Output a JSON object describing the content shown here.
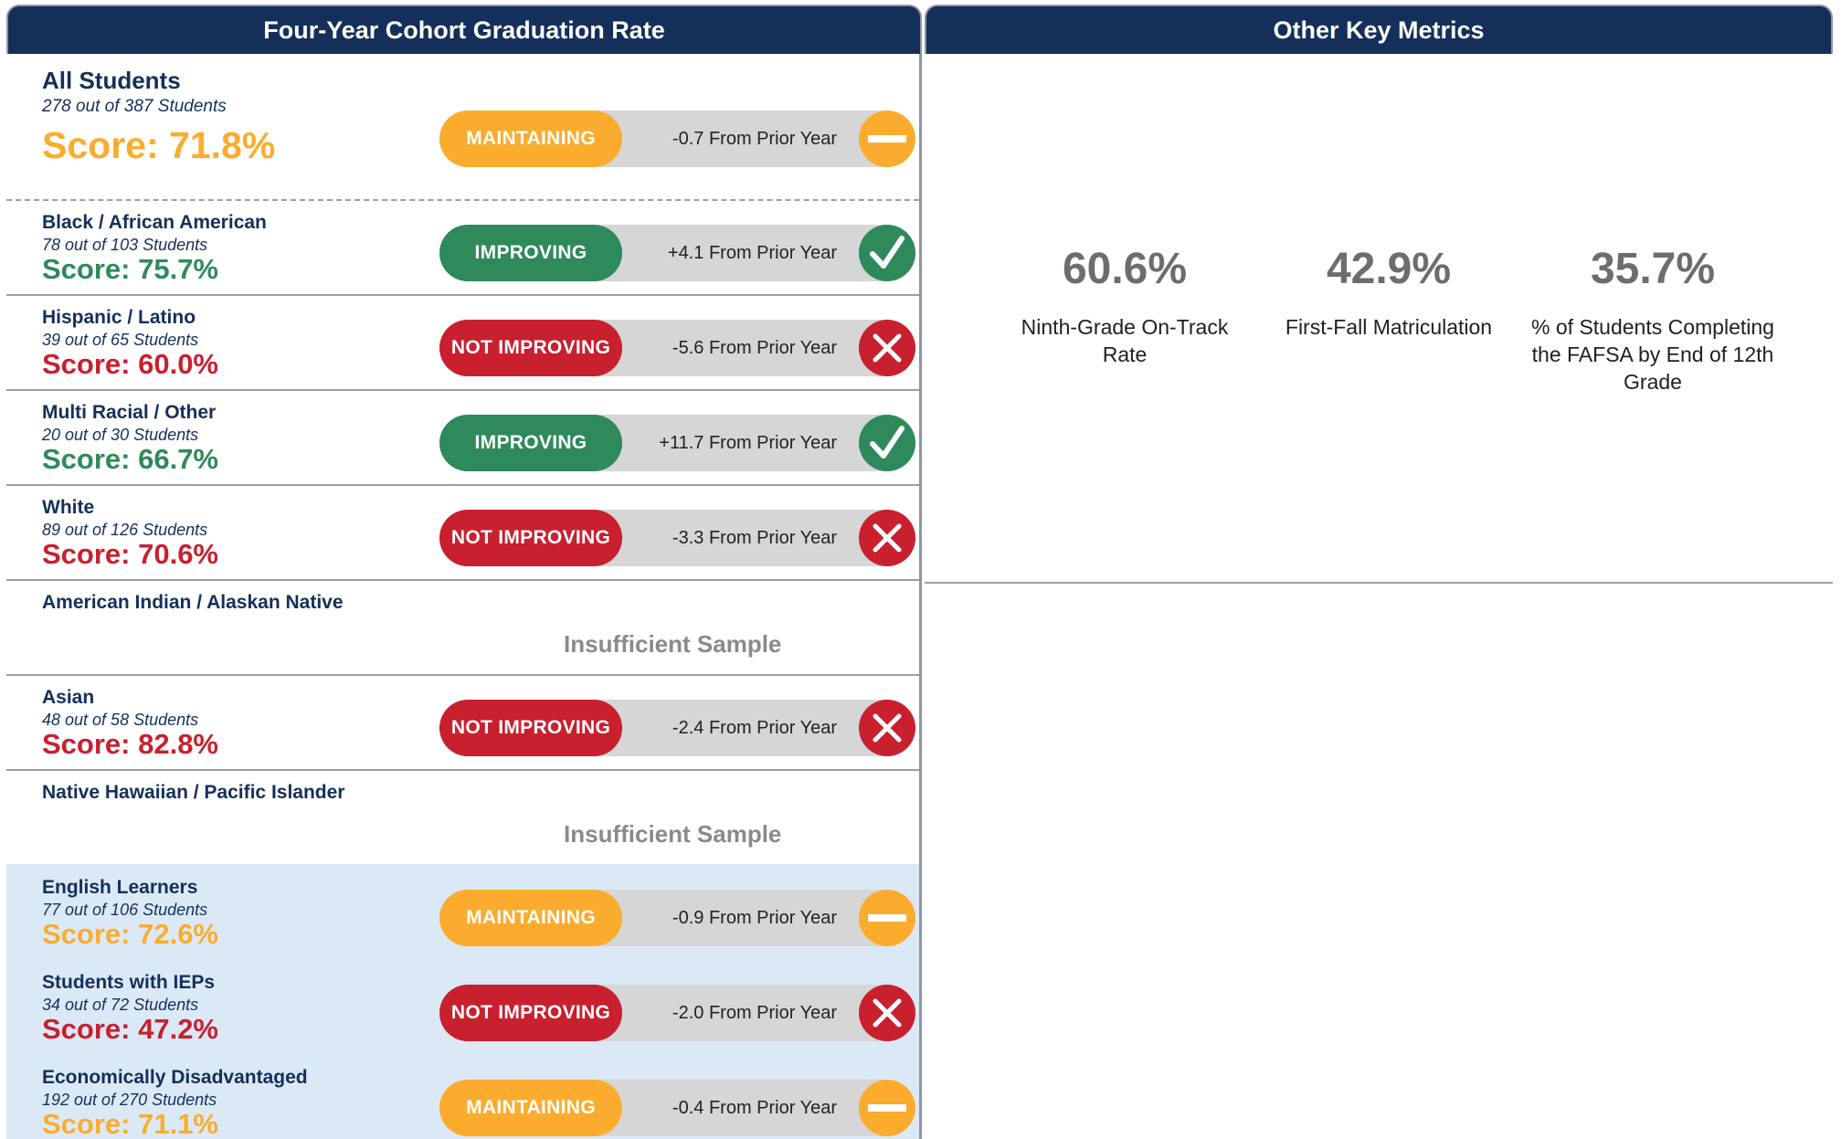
{
  "headers": {
    "left": "Four-Year Cohort Graduation Rate",
    "right": "Other Key Metrics"
  },
  "colors": {
    "header_bg": "#14305a",
    "maintaining": "#fbac2e",
    "improving": "#2f8a5b",
    "not_improving": "#c8202f",
    "highlight_bg": "#dbe9f6",
    "insufficient_text": "#8a8a8a"
  },
  "groups": [
    {
      "name": "All Students",
      "count": "278 out of 387 Students",
      "score": "Score: 71.8%",
      "status": "MAINTAINING",
      "change": "-0.7 From Prior Year",
      "icon": "minus-icon"
    },
    {
      "name": "Black / African American",
      "count": "78 out of 103 Students",
      "score": "Score: 75.7%",
      "status": "IMPROVING",
      "change": "+4.1 From Prior Year",
      "icon": "check-icon"
    },
    {
      "name": "Hispanic / Latino",
      "count": "39 out of 65 Students",
      "score": "Score: 60.0%",
      "status": "NOT IMPROVING",
      "change": "-5.6 From Prior Year",
      "icon": "x-icon"
    },
    {
      "name": "Multi Racial / Other",
      "count": "20 out of 30 Students",
      "score": "Score: 66.7%",
      "status": "IMPROVING",
      "change": "+11.7 From Prior Year",
      "icon": "check-icon"
    },
    {
      "name": "White",
      "count": "89 out of 126 Students",
      "score": "Score: 70.6%",
      "status": "NOT IMPROVING",
      "change": "-3.3 From Prior Year",
      "icon": "x-icon"
    },
    {
      "name": "American Indian / Alaskan Native",
      "insufficient": "Insufficient Sample"
    },
    {
      "name": "Asian",
      "count": "48 out of 58 Students",
      "score": "Score: 82.8%",
      "status": "NOT IMPROVING",
      "change": "-2.4 From Prior Year",
      "icon": "x-icon"
    },
    {
      "name": "Native Hawaiian / Pacific Islander",
      "insufficient": "Insufficient Sample"
    },
    {
      "name": "English Learners",
      "count": "77 out of 106 Students",
      "score": "Score: 72.6%",
      "status": "MAINTAINING",
      "change": "-0.9 From Prior Year",
      "icon": "minus-icon"
    },
    {
      "name": "Students with IEPs",
      "count": "34 out of 72 Students",
      "score": "Score: 47.2%",
      "status": "NOT IMPROVING",
      "change": "-2.0 From Prior Year",
      "icon": "x-icon"
    },
    {
      "name": "Economically Disadvantaged",
      "count": "192 out of 270 Students",
      "score": "Score: 71.1%",
      "status": "MAINTAINING",
      "change": "-0.4 From Prior Year",
      "icon": "minus-icon"
    }
  ],
  "metrics": [
    {
      "value": "60.6%",
      "label": "Ninth-Grade On-Track Rate"
    },
    {
      "value": "42.9%",
      "label": "First-Fall Matriculation"
    },
    {
      "value": "35.7%",
      "label": "% of Students Completing the FAFSA by End of 12th Grade"
    }
  ]
}
